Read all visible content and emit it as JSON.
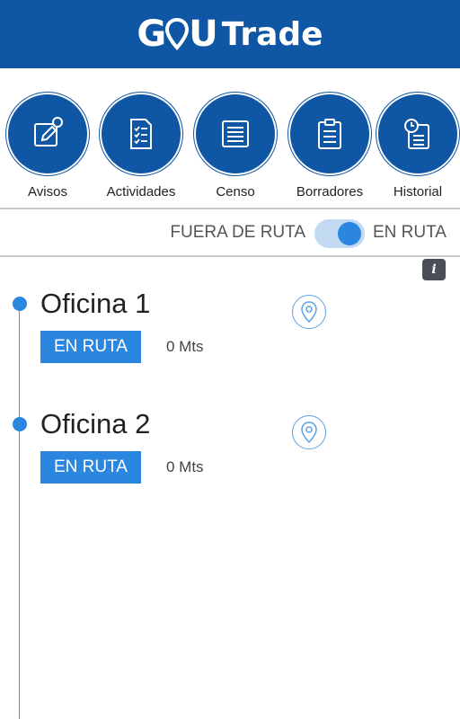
{
  "header": {
    "logo_g": "G",
    "logo_text": "Trade"
  },
  "menu": [
    {
      "label": "Avisos",
      "icon": "notice-edit-icon"
    },
    {
      "label": "Actividades",
      "icon": "checklist-icon"
    },
    {
      "label": "Censo",
      "icon": "list-icon"
    },
    {
      "label": "Borradores",
      "icon": "clipboard-icon"
    },
    {
      "label": "Historial",
      "icon": "history-icon"
    }
  ],
  "route_toggle": {
    "left_label": "FUERA DE RUTA",
    "right_label": "EN RUTA",
    "state": "EN RUTA"
  },
  "info_label": "i",
  "offices": [
    {
      "name": "Oficina 1",
      "status": "EN RUTA",
      "distance": "0 Mts"
    },
    {
      "name": "Oficina 2",
      "status": "EN RUTA",
      "distance": "0 Mts"
    }
  ],
  "colors": {
    "primary": "#0f56a4",
    "accent": "#2b86df"
  }
}
